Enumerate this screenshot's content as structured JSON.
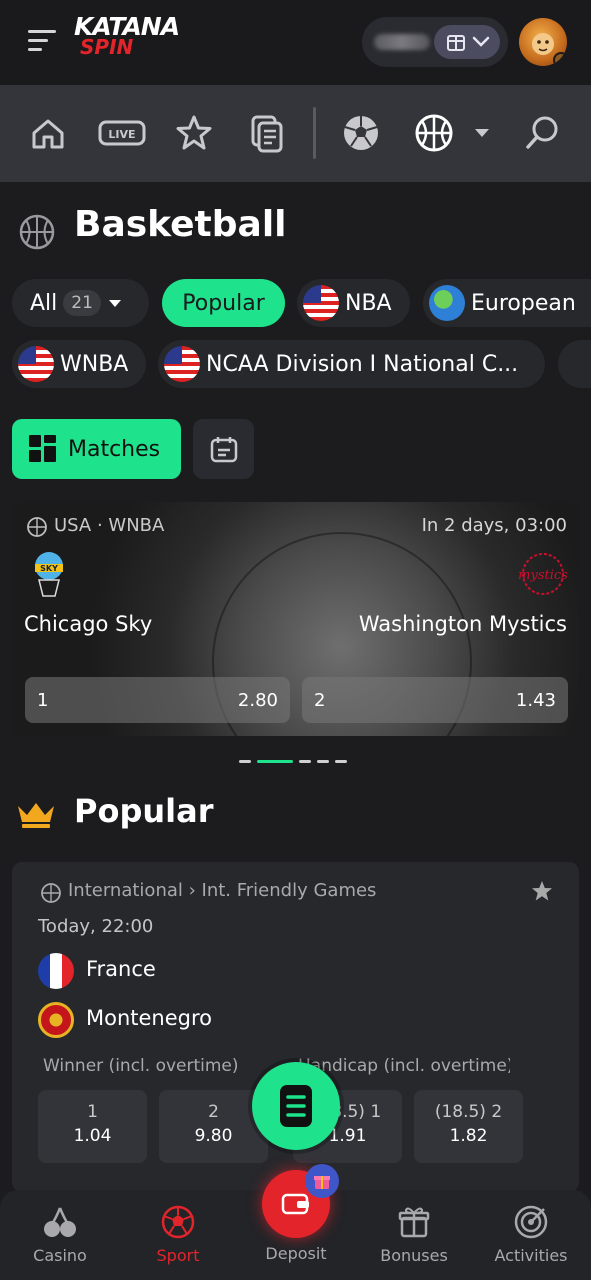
{
  "header": {
    "logo_line1": "KATANA",
    "logo_line2": "SPIN"
  },
  "sport_nav": {
    "items": [
      "home-icon",
      "live-icon",
      "favorites-icon",
      "betslip-icon",
      "soccer-icon",
      "basketball-icon",
      "chevron-down-icon",
      "search-icon"
    ],
    "live_label": "LIVE"
  },
  "page": {
    "title": "Basketball"
  },
  "filters": {
    "all_label": "All",
    "all_count": "21",
    "chips": [
      "Popular",
      "NBA",
      "European",
      "WNBA",
      "NCAA Division I National C..."
    ]
  },
  "tabs": {
    "matches": "Matches"
  },
  "featured": {
    "league": "USA · WNBA",
    "time": "In 2 days, 03:00",
    "home": "Chicago Sky",
    "away": "Washington Mystics",
    "odds": [
      {
        "label": "1",
        "value": "2.80"
      },
      {
        "label": "2",
        "value": "1.43"
      }
    ]
  },
  "popular": {
    "title": "Popular",
    "match": {
      "league": "International › Int. Friendly Games",
      "time": "Today, 22:00",
      "home": "France",
      "away": "Montenegro",
      "market1": "Winner (incl. overtime)",
      "market2": "Handicap (incl. overtime)",
      "odds": [
        {
          "label": "1",
          "value": "1.04"
        },
        {
          "label": "2",
          "value": "9.80"
        },
        {
          "label": "(18.5) 1",
          "value": "1.91"
        },
        {
          "label": "(18.5) 2",
          "value": "1.82"
        }
      ]
    }
  },
  "bottom_nav": {
    "items": [
      "Casino",
      "Sport",
      "Deposit",
      "Bonuses",
      "Activities"
    ]
  },
  "colors": {
    "accent": "#1ee38c",
    "brand_red": "#e3242b",
    "background": "#1c1c1e"
  }
}
